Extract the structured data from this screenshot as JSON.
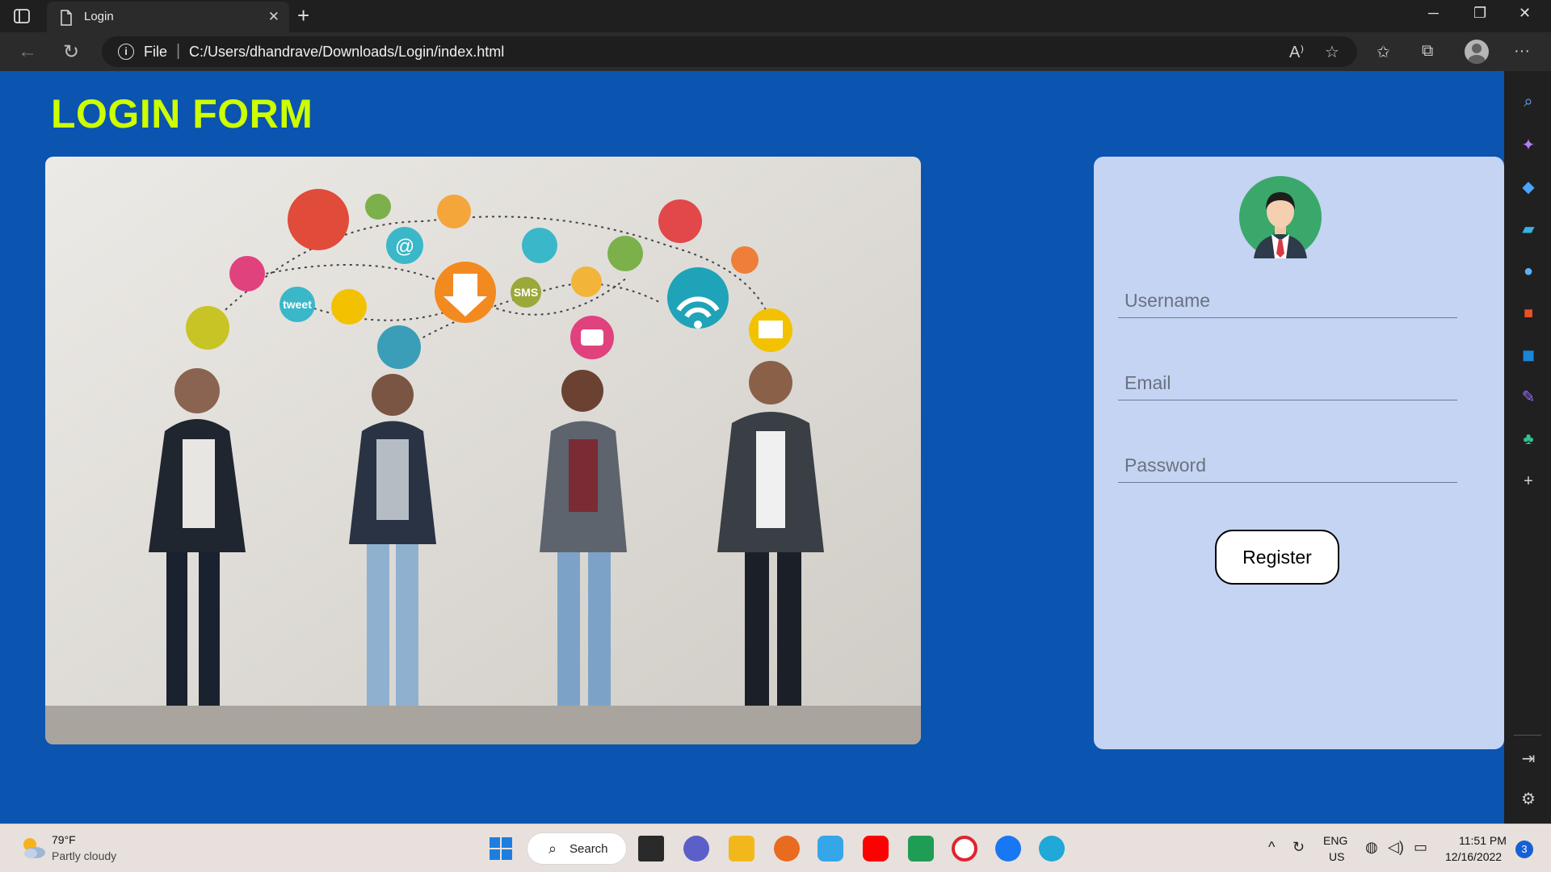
{
  "browser": {
    "tab_title": "Login",
    "address_scheme": "File",
    "url": "C:/Users/dhandrave/Downloads/Login/index.html"
  },
  "page": {
    "title": "LOGIN FORM",
    "form": {
      "username_placeholder": "Username",
      "email_placeholder": "Email",
      "password_placeholder": "Password",
      "register_label": "Register"
    },
    "hero_icon_labels": [
      "tweet",
      "SMS"
    ]
  },
  "taskbar": {
    "weather_temp": "79°F",
    "weather_condition": "Partly cloudy",
    "search_label": "Search",
    "language": "ENG",
    "region": "US",
    "time": "11:51 PM",
    "date": "12/16/2022",
    "notification_count": "3"
  },
  "colors": {
    "page_background": "#0b54b0",
    "title_color": "#ccff00",
    "card_background": "#c4d4f2"
  },
  "icons": [
    "tab-actions-icon",
    "document-icon",
    "close-icon",
    "new-tab-icon",
    "minimize-icon",
    "restore-icon",
    "window-close-icon",
    "back-icon",
    "refresh-icon",
    "info-icon",
    "read-aloud-icon",
    "add-favorite-icon",
    "favorites-icon",
    "collections-icon",
    "profile-icon",
    "more-icon",
    "search-icon",
    "copilot-icon",
    "shopping-icon",
    "tools-icon",
    "games-icon",
    "office-icon",
    "outlook-icon",
    "designer-icon",
    "drop-icon",
    "add-icon",
    "sidebar-toggle-icon",
    "settings-icon"
  ]
}
